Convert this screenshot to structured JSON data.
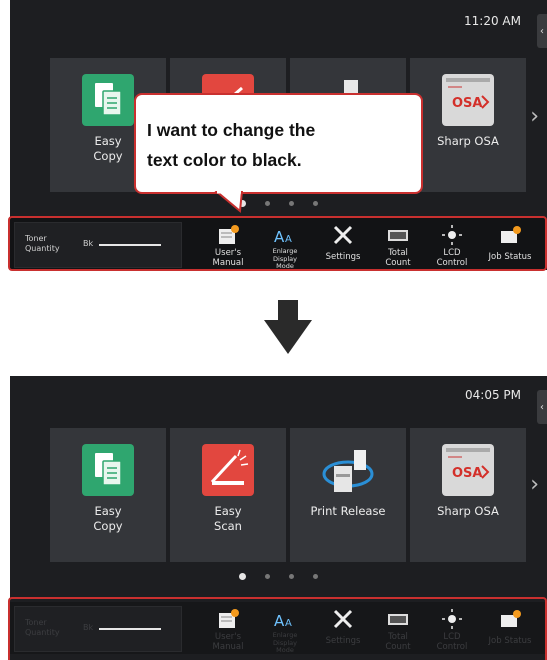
{
  "colors": {
    "highlight": "#c9302f",
    "screen_bg": "#1d1e21",
    "tile_bg": "#34363a"
  },
  "top_screen": {
    "time": "11:20 AM",
    "tiles": [
      {
        "label": "Easy\nCopy",
        "icon": "easy-copy-icon"
      },
      {
        "label": "",
        "icon": "easy-scan-icon"
      },
      {
        "label": "",
        "icon": "print-release-icon"
      },
      {
        "label": "Sharp OSA",
        "icon": "sharp-osa-icon"
      }
    ],
    "callout": "I want to change the\ntext color to black.",
    "taskbar": {
      "toner_label": "Toner\nQuantity",
      "toner_bk": "Bk",
      "items": [
        {
          "label": "User's\nManual",
          "icon": "book-icon"
        },
        {
          "label": "Enlarge\nDisplay\nMode",
          "icon": "enlarge-text-icon"
        },
        {
          "label": "Settings",
          "icon": "tools-icon"
        },
        {
          "label": "Total\nCount",
          "icon": "counter-icon"
        },
        {
          "label": "LCD\nControl",
          "icon": "brightness-icon"
        },
        {
          "label": "Job Status",
          "icon": "job-status-icon"
        }
      ]
    }
  },
  "bottom_screen": {
    "time": "04:05 PM",
    "tiles": [
      {
        "label": "Easy\nCopy",
        "icon": "easy-copy-icon"
      },
      {
        "label": "Easy\nScan",
        "icon": "easy-scan-icon"
      },
      {
        "label": "Print Release",
        "icon": "print-release-icon"
      },
      {
        "label": "Sharp OSA",
        "icon": "sharp-osa-icon"
      }
    ],
    "taskbar": {
      "toner_label": "Toner\nQuantity",
      "toner_bk": "Bk",
      "items": [
        {
          "label": "User's\nManual",
          "icon": "book-icon"
        },
        {
          "label": "Enlarge\nDisplay\nMode",
          "icon": "enlarge-text-icon"
        },
        {
          "label": "Settings",
          "icon": "tools-icon"
        },
        {
          "label": "Total\nCount",
          "icon": "counter-icon"
        },
        {
          "label": "LCD\nControl",
          "icon": "brightness-icon"
        },
        {
          "label": "Job Status",
          "icon": "job-status-icon"
        }
      ]
    }
  }
}
